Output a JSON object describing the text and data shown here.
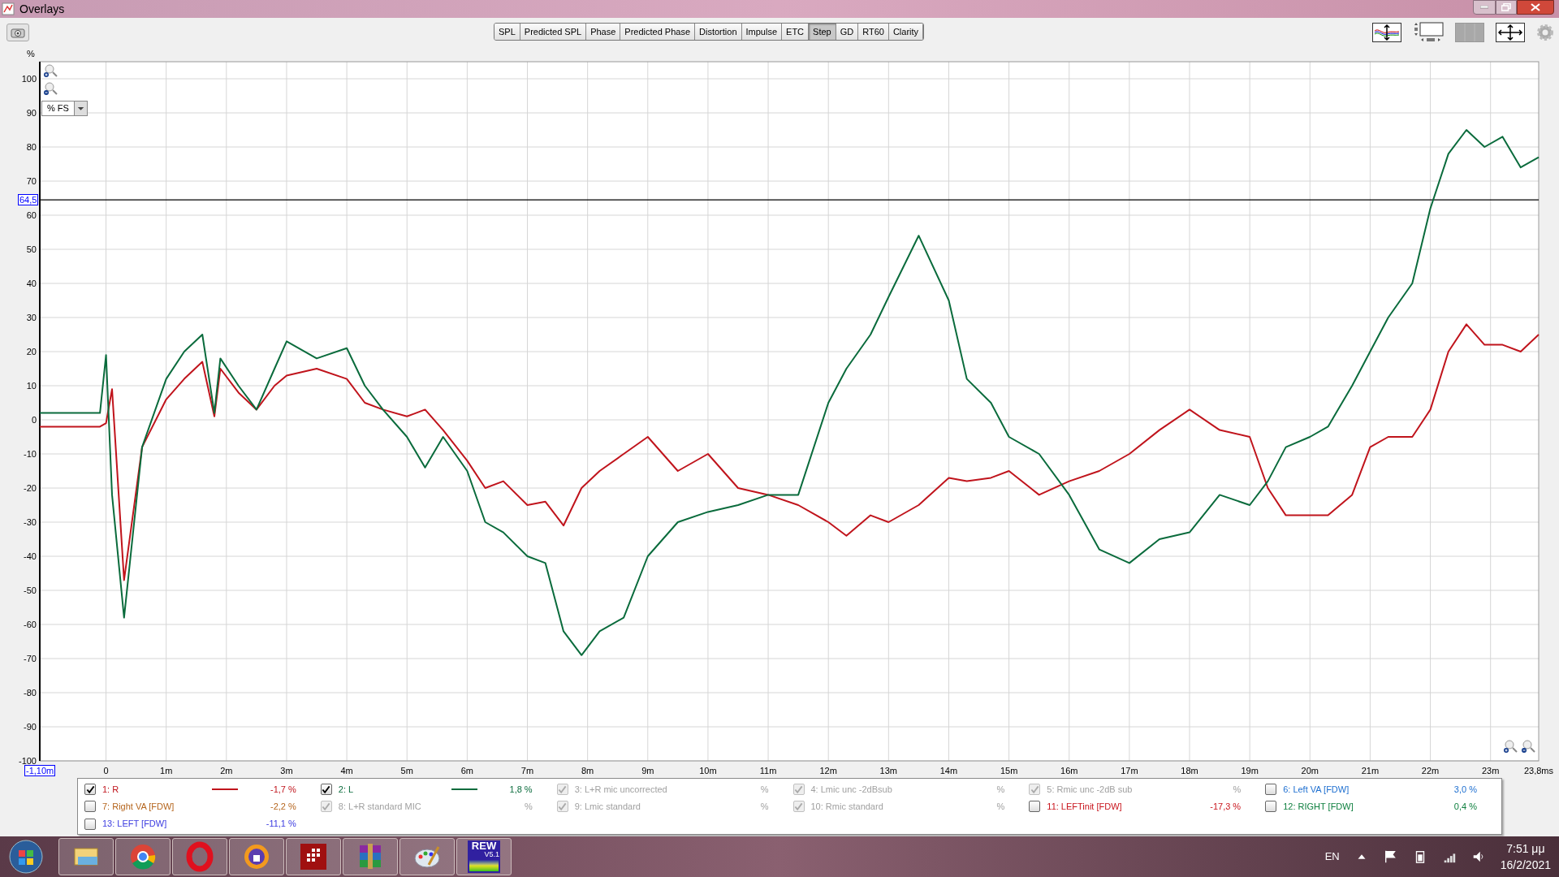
{
  "window": {
    "title": "Overlays"
  },
  "tabs": [
    {
      "label": "SPL",
      "selected": false
    },
    {
      "label": "Predicted SPL",
      "selected": false
    },
    {
      "label": "Phase",
      "selected": false
    },
    {
      "label": "Predicted Phase",
      "selected": false
    },
    {
      "label": "Distortion",
      "selected": false
    },
    {
      "label": "Impulse",
      "selected": false
    },
    {
      "label": "ETC",
      "selected": false
    },
    {
      "label": "Step",
      "selected": true
    },
    {
      "label": "GD",
      "selected": false
    },
    {
      "label": "RT60",
      "selected": false
    },
    {
      "label": "Clarity",
      "selected": false
    }
  ],
  "plot": {
    "unit_select": "% FS",
    "chart_data": {
      "type": "line",
      "ylabel": "%",
      "xlim": [
        -1.1,
        23.8
      ],
      "ylim": [
        -100,
        105
      ],
      "yticks": [
        100,
        90,
        80,
        70,
        60,
        50,
        40,
        30,
        20,
        10,
        0,
        -10,
        -20,
        -30,
        -40,
        -50,
        -60,
        -70,
        -80,
        -90,
        -100
      ],
      "xticks": [
        {
          "value": -1.1,
          "label": "-1,10m"
        },
        {
          "value": 0,
          "label": "0"
        },
        {
          "value": 1,
          "label": "1m"
        },
        {
          "value": 2,
          "label": "2m"
        },
        {
          "value": 3,
          "label": "3m"
        },
        {
          "value": 4,
          "label": "4m"
        },
        {
          "value": 5,
          "label": "5m"
        },
        {
          "value": 6,
          "label": "6m"
        },
        {
          "value": 7,
          "label": "7m"
        },
        {
          "value": 8,
          "label": "8m"
        },
        {
          "value": 9,
          "label": "9m"
        },
        {
          "value": 10,
          "label": "10m"
        },
        {
          "value": 11,
          "label": "11m"
        },
        {
          "value": 12,
          "label": "12m"
        },
        {
          "value": 13,
          "label": "13m"
        },
        {
          "value": 14,
          "label": "14m"
        },
        {
          "value": 15,
          "label": "15m"
        },
        {
          "value": 16,
          "label": "16m"
        },
        {
          "value": 17,
          "label": "17m"
        },
        {
          "value": 18,
          "label": "18m"
        },
        {
          "value": 19,
          "label": "19m"
        },
        {
          "value": 20,
          "label": "20m"
        },
        {
          "value": 21,
          "label": "21m"
        },
        {
          "value": 22,
          "label": "22m"
        },
        {
          "value": 23,
          "label": "23m"
        },
        {
          "value": 23.8,
          "label": "23,8ms"
        }
      ],
      "grid": true,
      "ref_lines": [
        {
          "axis": "y",
          "value": 64.5,
          "label": "64,5"
        }
      ],
      "x": [
        -1.1,
        -0.1,
        0,
        0.1,
        0.3,
        0.6,
        1,
        1.3,
        1.6,
        1.8,
        1.9,
        2.2,
        2.5,
        2.8,
        3,
        3.5,
        4,
        4.3,
        4.6,
        5,
        5.3,
        5.6,
        6,
        6.3,
        6.6,
        7,
        7.3,
        7.6,
        7.9,
        8.2,
        8.6,
        9,
        9.5,
        10,
        10.5,
        11,
        11.5,
        12,
        12.3,
        12.7,
        13,
        13.5,
        14,
        14.3,
        14.7,
        15,
        15.5,
        16,
        16.5,
        17,
        17.5,
        18,
        18.5,
        19,
        19.3,
        19.6,
        20,
        20.3,
        20.7,
        21,
        21.3,
        21.7,
        22,
        22.3,
        22.6,
        22.9,
        23.2,
        23.5,
        23.8
      ],
      "series": [
        {
          "color": "#c0141c",
          "values": [
            -2,
            -2,
            -1,
            9,
            -47,
            -8,
            6,
            12,
            17,
            1,
            15,
            8,
            3,
            10,
            13,
            15,
            12,
            5,
            3,
            1,
            3,
            -3,
            -12,
            -20,
            -18,
            -25,
            -24,
            -31,
            -20,
            -15,
            -10,
            -5,
            -15,
            -10,
            -20,
            -22,
            -25,
            -30,
            -34,
            -28,
            -30,
            -25,
            -17,
            -18,
            -17,
            -15,
            -22,
            -18,
            -15,
            -10,
            -3,
            3,
            -3,
            -5,
            -20,
            -28,
            -28,
            -28,
            -22,
            -8,
            -5,
            -5,
            3,
            20,
            28,
            22,
            22,
            20,
            25
          ]
        },
        {
          "color": "#0a6b3c",
          "values": [
            2,
            2,
            19,
            -22,
            -58,
            -8,
            12,
            20,
            25,
            2,
            18,
            10,
            3,
            15,
            23,
            18,
            21,
            10,
            3,
            -5,
            -14,
            -5,
            -15,
            -30,
            -33,
            -40,
            -42,
            -62,
            -69,
            -62,
            -58,
            -40,
            -30,
            -27,
            -25,
            -22,
            -22,
            5,
            15,
            25,
            36,
            54,
            35,
            12,
            5,
            -5,
            -10,
            -22,
            -38,
            -42,
            -35,
            -33,
            -22,
            -25,
            -18,
            -8,
            -5,
            -2,
            10,
            20,
            30,
            40,
            62,
            78,
            85,
            80,
            83,
            74,
            77
          ]
        }
      ]
    }
  },
  "legend": {
    "items": [
      {
        "label": "1: R",
        "value": "-1,7 %",
        "checked": true,
        "disabled": false,
        "color": "#c0141c",
        "line": true
      },
      {
        "label": "2: L",
        "value": "1,8 %",
        "checked": true,
        "disabled": false,
        "color": "#0a6b3c",
        "line": true
      },
      {
        "label": "3: L+R mic uncorrected",
        "value": "%",
        "checked": true,
        "disabled": true,
        "color": "#a0a0a0"
      },
      {
        "label": "4: Lmic unc -2dBsub",
        "value": "%",
        "checked": true,
        "disabled": true,
        "color": "#a0a0a0"
      },
      {
        "label": "5: Rmic unc -2dB sub",
        "value": "%",
        "checked": true,
        "disabled": true,
        "color": "#a0a0a0"
      },
      {
        "label": "6: Left VA [FDW]",
        "value": "3,0 %",
        "checked": false,
        "disabled": false,
        "color": "#1e6fd0"
      },
      {
        "label": "7: Right VA [FDW]",
        "value": "-2,2 %",
        "checked": false,
        "disabled": false,
        "color": "#b5651d"
      },
      {
        "label": "8: L+R standard MIC",
        "value": "%",
        "checked": true,
        "disabled": true,
        "color": "#a0a0a0"
      },
      {
        "label": "9: Lmic standard",
        "value": "%",
        "checked": true,
        "disabled": true,
        "color": "#a0a0a0"
      },
      {
        "label": "10: Rmic standard",
        "value": "%",
        "checked": true,
        "disabled": true,
        "color": "#a0a0a0"
      },
      {
        "label": "11: LEFTinit [FDW]",
        "value": "-17,3 %",
        "checked": false,
        "disabled": false,
        "color": "#c8141c"
      },
      {
        "label": "12: RIGHT [FDW]",
        "value": "0,4 %",
        "checked": false,
        "disabled": false,
        "color": "#108040"
      },
      {
        "label": "13: LEFT [FDW]",
        "value": "-11,1 %",
        "checked": false,
        "disabled": false,
        "color": "#3a3ae0"
      }
    ]
  },
  "taskbar": {
    "apps": [
      {
        "kind": "explorer"
      },
      {
        "kind": "chrome"
      },
      {
        "kind": "opera"
      },
      {
        "kind": "browser"
      },
      {
        "kind": "grid"
      },
      {
        "kind": "archive"
      },
      {
        "kind": "paint"
      },
      {
        "kind": "rew",
        "label": "REW",
        "version": "V5.1"
      }
    ],
    "language": "EN",
    "time": "7:51 μμ",
    "date": "16/2/2021"
  }
}
